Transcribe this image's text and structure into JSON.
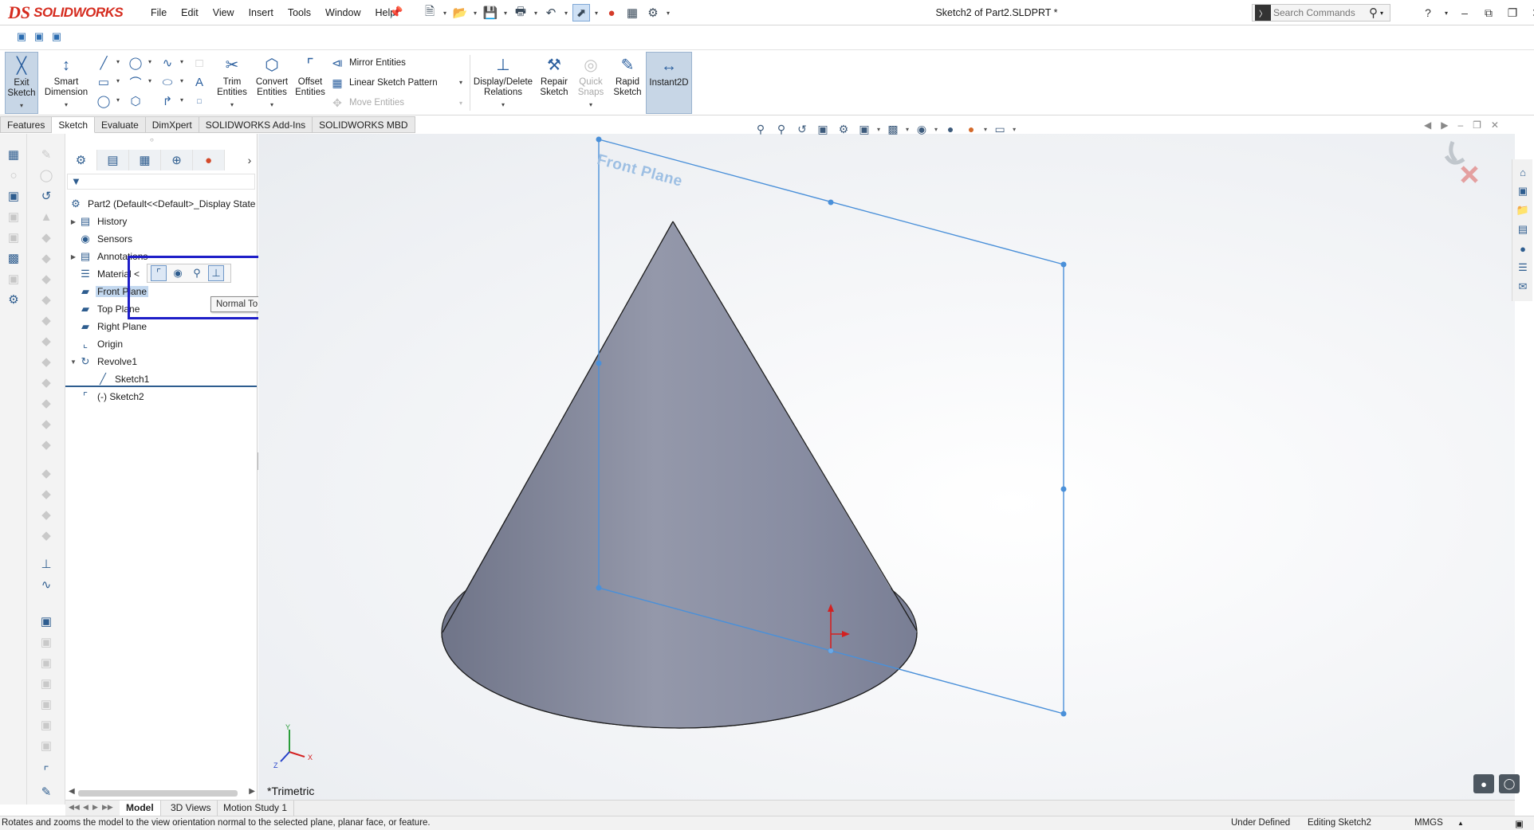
{
  "app": {
    "logo_mark": "DS",
    "logo_name": "SOLIDWORKS",
    "document_title": "Sketch2 of Part2.SLDPRT *"
  },
  "menu": [
    "File",
    "Edit",
    "View",
    "Insert",
    "Tools",
    "Window",
    "Help"
  ],
  "search": {
    "placeholder": "Search Commands"
  },
  "command_manager": {
    "exit_sketch": "Exit Sketch",
    "smart_dimension": "Smart Dimension",
    "trim_entities": "Trim Entities",
    "convert_entities": "Convert Entities",
    "offset_entities": "Offset Entities",
    "mirror_entities": "Mirror Entities",
    "linear_sketch_pattern": "Linear Sketch Pattern",
    "move_entities": "Move Entities",
    "display_delete_relations": "Display/Delete Relations",
    "repair_sketch": "Repair Sketch",
    "quick_snaps": "Quick Snaps",
    "rapid_sketch": "Rapid Sketch",
    "instant2d": "Instant2D"
  },
  "tabs": [
    {
      "label": "Features",
      "active": false
    },
    {
      "label": "Sketch",
      "active": true
    },
    {
      "label": "Evaluate",
      "active": false
    },
    {
      "label": "DimXpert",
      "active": false
    },
    {
      "label": "SOLIDWORKS Add-Ins",
      "active": false
    },
    {
      "label": "SOLIDWORKS MBD",
      "active": false
    }
  ],
  "feature_tree": {
    "root": "Part2  (Default<<Default>_Display State",
    "items": [
      {
        "label": "History",
        "icon": "history-icon"
      },
      {
        "label": "Sensors",
        "icon": "sensor-icon"
      },
      {
        "label": "Annotations",
        "icon": "annotations-icon"
      },
      {
        "label": "Material <",
        "icon": "material-icon"
      },
      {
        "label": "Front Plane",
        "icon": "plane-icon",
        "selected": true
      },
      {
        "label": "Top Plane",
        "icon": "plane-icon"
      },
      {
        "label": "Right Plane",
        "icon": "plane-icon"
      },
      {
        "label": "Origin",
        "icon": "origin-icon"
      },
      {
        "label": "Revolve1",
        "icon": "revolve-icon"
      },
      {
        "label": "Sketch1",
        "icon": "sketch-icon"
      },
      {
        "label": "(-) Sketch2",
        "icon": "sketch-icon"
      }
    ]
  },
  "context_toolbar": {
    "tooltip": "Normal To"
  },
  "viewport": {
    "plane_label": "Front Plane",
    "view_orientation": "*Trimetric",
    "triad": {
      "x": "X",
      "y": "Y",
      "z": "Z"
    },
    "colors": {
      "plane_edge": "#4a90d9",
      "cone_fill": "#8a8fa0",
      "origin_red": "#d42020",
      "highlight_box": "#1e1ec8"
    }
  },
  "bottom_tabs": [
    {
      "label": "Model",
      "active": true
    },
    {
      "label": "3D Views",
      "active": false
    },
    {
      "label": "Motion Study 1",
      "active": false
    }
  ],
  "status": {
    "message": "Rotates and zooms the model to the view orientation normal to the selected plane, planar face, or feature.",
    "sketch_state": "Under Defined",
    "editing": "Editing Sketch2",
    "units": "MMGS"
  }
}
